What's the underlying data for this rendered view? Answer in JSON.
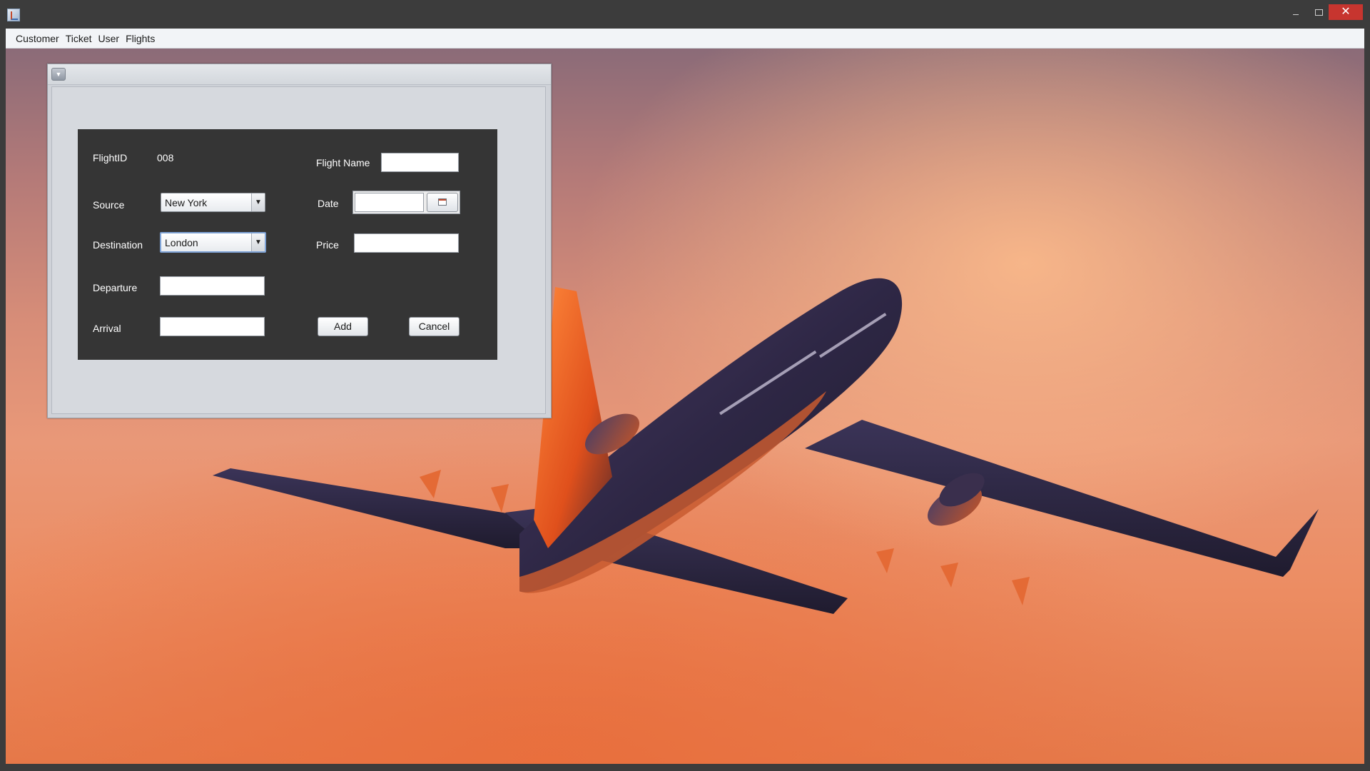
{
  "window": {
    "title": "",
    "minimize_glyph": "–",
    "close_glyph": "✕"
  },
  "menubar": {
    "items": [
      {
        "label": "Customer"
      },
      {
        "label": "Ticket"
      },
      {
        "label": "User"
      },
      {
        "label": "Flights"
      }
    ]
  },
  "internal_frame": {
    "menu_glyph": "▼"
  },
  "form": {
    "flight_id_label": "FlightID",
    "flight_id_value": "008",
    "flight_name_label": "Flight Name",
    "flight_name_value": "",
    "source_label": "Source",
    "source_value": "New York",
    "date_label": "Date",
    "date_value": "",
    "destination_label": "Destination",
    "destination_value": "London",
    "price_label": "Price",
    "price_value": "",
    "departure_label": "Departure",
    "departure_value": "",
    "arrival_label": "Arrival",
    "arrival_value": "",
    "add_label": "Add",
    "cancel_label": "Cancel",
    "dropdown_glyph": "▼"
  },
  "colors": {
    "panel_dark": "#353535",
    "close_red": "#c7352f",
    "sky_orange": "#e99878"
  },
  "icons": {
    "app": "java-app-icon",
    "calendar": "calendar-icon",
    "frame_menu": "chevron-down-icon"
  }
}
